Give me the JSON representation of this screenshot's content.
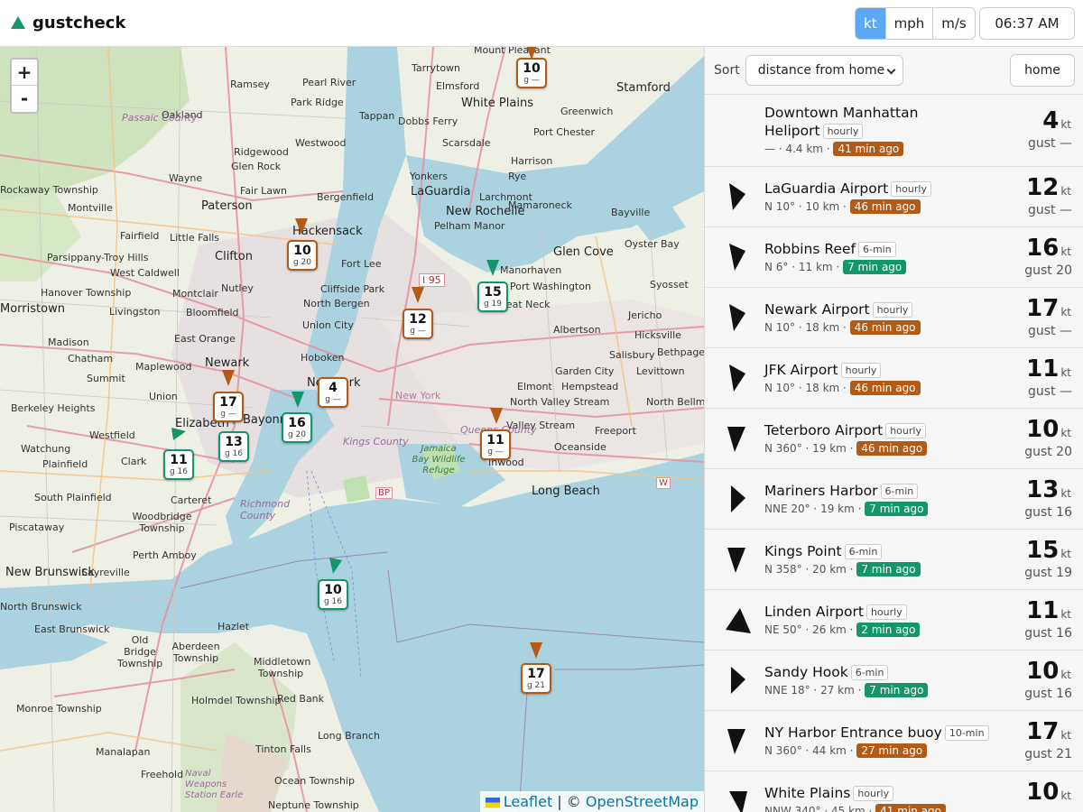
{
  "app": {
    "title": "gustcheck",
    "icon": "triangle-logo-icon"
  },
  "header": {
    "units": [
      {
        "label": "kt",
        "active": true
      },
      {
        "label": "mph",
        "active": false
      },
      {
        "label": "m/s",
        "active": false
      }
    ],
    "clock": "06:37 AM"
  },
  "map": {
    "zoom_in": "+",
    "zoom_out": "-",
    "attribution": {
      "leaflet": "Leaflet",
      "sep": " | © ",
      "osm": "OpenStreetMap"
    },
    "labels": {
      "mount_pleasant": "Mount Pleasant",
      "tarrytown": "Tarrytown",
      "stamford": "Stamford",
      "ramsey": "Ramsey",
      "pearl_river": "Pearl River",
      "elmsford": "Elmsford",
      "white_plains": "White Plains",
      "greenwich": "Greenwich",
      "oakland": "Oakland",
      "passaic_county": "Passaic County",
      "park_ridge": "Park Ridge",
      "tappan": "Tappan",
      "dobbs_ferry": "Dobbs Ferry",
      "port_chester": "Port Chester",
      "ridgewood": "Ridgewood",
      "westwood": "Westwood",
      "scarsdale": "Scarsdale",
      "glen_rock": "Glen Rock",
      "harrison": "Harrison",
      "wayne": "Wayne",
      "fair_lawn": "Fair Lawn",
      "yonkers": "Yonkers",
      "rye": "Rye",
      "rockaway_twp": "Rockaway Township",
      "bergenfield": "Bergenfield",
      "larchmont": "Larchmont",
      "montville": "Montville",
      "paterson": "Paterson",
      "mamaroneck": "Mamaroneck",
      "laguardia": "LaGuardia",
      "new_rochelle": "New Rochelle",
      "bayville": "Bayville",
      "fairfield": "Fairfield",
      "little_falls": "Little Falls",
      "hackensack": "Hackensack",
      "pelham_manor": "Pelham Manor",
      "oyster_bay": "Oyster Bay",
      "clifton": "Clifton",
      "glen_cove": "Glen Cove",
      "troy_hills": "Parsippany-Troy Hills",
      "fort_lee": "Fort Lee",
      "manorhaven": "Manorhaven",
      "west_caldwell": "West Caldwell",
      "i95": "I 95",
      "port_washington": "Port Washington",
      "syosset": "Syosset",
      "hanover": "Hanover Township",
      "montclair": "Montclair",
      "nutley": "Nutley",
      "cliffside_park": "Cliffside Park",
      "livingston": "Livingston",
      "north_bergen": "North Bergen",
      "great_neck": "Great Neck",
      "jericho": "Jericho",
      "morristown": "Morristown",
      "bloomfield": "Bloomfield",
      "union_city": "Union City",
      "albertson": "Albertson",
      "hicksville": "Hicksville",
      "east_orange": "East Orange",
      "madison": "Madison",
      "bethpage": "Bethpage",
      "chatham": "Chatham",
      "newark": "Newark",
      "hoboken": "Hoboken",
      "salisbury": "Salisbury",
      "maplewood": "Maplewood",
      "summit": "Summit",
      "new_york": "New York",
      "garden_city": "Garden City",
      "levittown": "Levittown",
      "union": "Union",
      "elmont": "Elmont",
      "hempstead": "Hempstead",
      "berkeley_heights": "Berkeley Heights",
      "bayonne": "Bayonne",
      "north_valley_stream": "North Valley Stream",
      "north_bellmore": "North Bellmore",
      "elizabeth": "Elizabeth",
      "kings_county": "Kings County",
      "queens_county": "Queens County",
      "valley_stream": "Valley Stream",
      "freeport": "Freeport",
      "watchung": "Watchung",
      "westfield": "Westfield",
      "jamaica_bay": "Jamaica Bay Wildlife Refuge",
      "inwood": "Inwood",
      "oceanside": "Oceanside",
      "clark": "Clark",
      "plainfield": "Plainfield",
      "long_beach": "Long Beach",
      "carteret": "Carteret",
      "south_plainfield": "South Plainfield",
      "richmond_county": "Richmond County",
      "woodbridge": "Woodbridge Township",
      "piscataway": "Piscataway",
      "perth_amboy": "Perth Amboy",
      "new_brunswick": "New Brunswick",
      "sayreville": "Sayreville",
      "north_brunswick": "North Brunswick",
      "east_brunswick": "East Brunswick",
      "hazlet": "Hazlet",
      "old_bridge": "Old Bridge Township",
      "aberdeen": "Aberdeen Township",
      "middletown": "Middletown Township",
      "holmdel": "Holmdel Township",
      "red_bank": "Red Bank",
      "monroe": "Monroe Township",
      "long_branch": "Long Branch",
      "manalapan": "Manalapan",
      "tinton_falls": "Tinton Falls",
      "freehold": "Freehold",
      "naval_weapons": "Naval Weapons Station Earle",
      "ocean_twp": "Ocean Township",
      "neptune": "Neptune Township",
      "bp": "BP",
      "w": "W",
      "nyc": "New York"
    },
    "markers": [
      {
        "value": "10",
        "gust": "g —",
        "color": "orange"
      },
      {
        "value": "10",
        "gust": "g 20",
        "color": "orange"
      },
      {
        "value": "12",
        "gust": "g —",
        "color": "orange"
      },
      {
        "value": "15",
        "gust": "g 19",
        "color": "green"
      },
      {
        "value": "4",
        "gust": "g —",
        "color": "orange"
      },
      {
        "value": "17",
        "gust": "g —",
        "color": "orange"
      },
      {
        "value": "16",
        "gust": "g 20",
        "color": "green"
      },
      {
        "value": "13",
        "gust": "g 16",
        "color": "green"
      },
      {
        "value": "11",
        "gust": "g 16",
        "color": "green"
      },
      {
        "value": "11",
        "gust": "g —",
        "color": "orange"
      },
      {
        "value": "10",
        "gust": "g 16",
        "color": "green"
      },
      {
        "value": "17",
        "gust": "g 21",
        "color": "orange"
      }
    ]
  },
  "panel": {
    "sort_label": "Sort",
    "sort_value": "distance from home",
    "home_label": "home",
    "unit": "kt",
    "stations": [
      {
        "name": "Downtown Manhattan Heliport",
        "type": "hourly",
        "dir": "— · 4.4 km ·",
        "age": "41 min ago",
        "age_color": "orange",
        "speed": "4",
        "gust": "gust —",
        "arrow": false
      },
      {
        "name": "LaGuardia Airport",
        "type": "hourly",
        "dir": "N 10° · 10 km ·",
        "age": "46 min ago",
        "age_color": "orange",
        "speed": "12",
        "gust": "gust —",
        "arrow": true
      },
      {
        "name": "Robbins Reef",
        "type": "6-min",
        "dir": "N 6° · 11 km ·",
        "age": "7 min ago",
        "age_color": "green",
        "speed": "16",
        "gust": "gust 20",
        "arrow": true
      },
      {
        "name": "Newark Airport",
        "type": "hourly",
        "dir": "N 10° · 18 km ·",
        "age": "46 min ago",
        "age_color": "orange",
        "speed": "17",
        "gust": "gust —",
        "arrow": true
      },
      {
        "name": "JFK Airport",
        "type": "hourly",
        "dir": "N 10° · 18 km ·",
        "age": "46 min ago",
        "age_color": "orange",
        "speed": "11",
        "gust": "gust —",
        "arrow": true
      },
      {
        "name": "Teterboro Airport",
        "type": "hourly",
        "dir": "N 360° · 19 km ·",
        "age": "46 min ago",
        "age_color": "orange",
        "speed": "10",
        "gust": "gust 20",
        "arrow": true
      },
      {
        "name": "Mariners Harbor",
        "type": "6-min",
        "dir": "NNE 20° · 19 km ·",
        "age": "7 min ago",
        "age_color": "green",
        "speed": "13",
        "gust": "gust 16",
        "arrow": true
      },
      {
        "name": "Kings Point",
        "type": "6-min",
        "dir": "N 358° · 20 km ·",
        "age": "7 min ago",
        "age_color": "green",
        "speed": "15",
        "gust": "gust 19",
        "arrow": true
      },
      {
        "name": "Linden Airport",
        "type": "hourly",
        "dir": "NE 50° · 26 km ·",
        "age": "2 min ago",
        "age_color": "green",
        "speed": "11",
        "gust": "gust 16",
        "arrow": true
      },
      {
        "name": "Sandy Hook",
        "type": "6-min",
        "dir": "NNE 18° · 27 km ·",
        "age": "7 min ago",
        "age_color": "green",
        "speed": "10",
        "gust": "gust 16",
        "arrow": true
      },
      {
        "name": "NY Harbor Entrance buoy",
        "type": "10-min",
        "dir": "N 360° · 44 km ·",
        "age": "27 min ago",
        "age_color": "orange",
        "speed": "17",
        "gust": "gust 21",
        "arrow": true
      },
      {
        "name": "White Plains",
        "type": "hourly",
        "dir": "NNW 340° · 45 km ·",
        "age": "41 min ago",
        "age_color": "orange",
        "speed": "10",
        "gust": "",
        "arrow": true
      }
    ]
  },
  "colors": {
    "orange": "#b35a14",
    "green": "#14966a",
    "accent": "#5ba8f5",
    "water": "#aad3df"
  }
}
